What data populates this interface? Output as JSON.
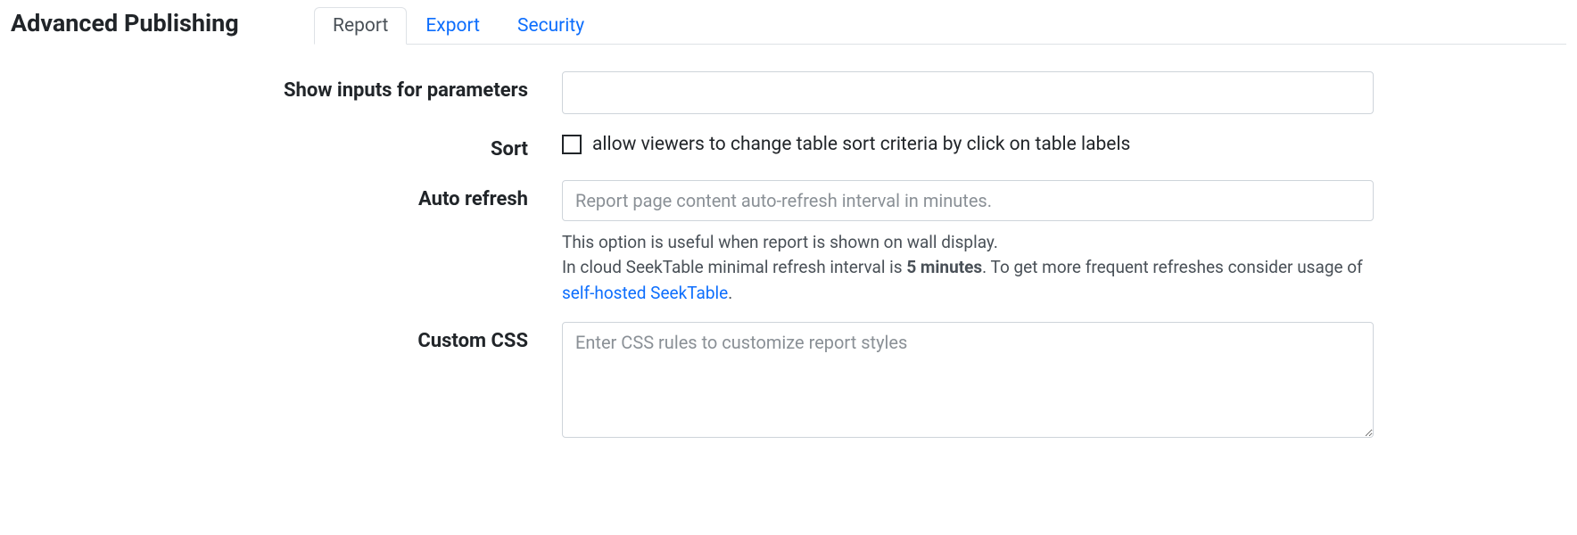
{
  "section_title": "Advanced Publishing",
  "tabs": [
    {
      "label": "Report",
      "active": true
    },
    {
      "label": "Export",
      "active": false
    },
    {
      "label": "Security",
      "active": false
    }
  ],
  "fields": {
    "show_inputs": {
      "label": "Show inputs for parameters",
      "value": ""
    },
    "sort": {
      "label": "Sort",
      "checkbox_label": "allow viewers to change table sort criteria by click on table labels",
      "checked": false
    },
    "auto_refresh": {
      "label": "Auto refresh",
      "placeholder": "Report page content auto-refresh interval in minutes.",
      "value": "",
      "help_line1": "This option is useful when report is shown on wall display.",
      "help_line2_before": "In cloud SeekTable minimal refresh interval is ",
      "help_line2_bold": "5 minutes",
      "help_line2_after": ". To get more frequent refreshes consider usage of ",
      "help_link": "self-hosted SeekTable",
      "help_line2_end": "."
    },
    "custom_css": {
      "label": "Custom CSS",
      "placeholder": "Enter CSS rules to customize report styles",
      "value": ""
    }
  }
}
